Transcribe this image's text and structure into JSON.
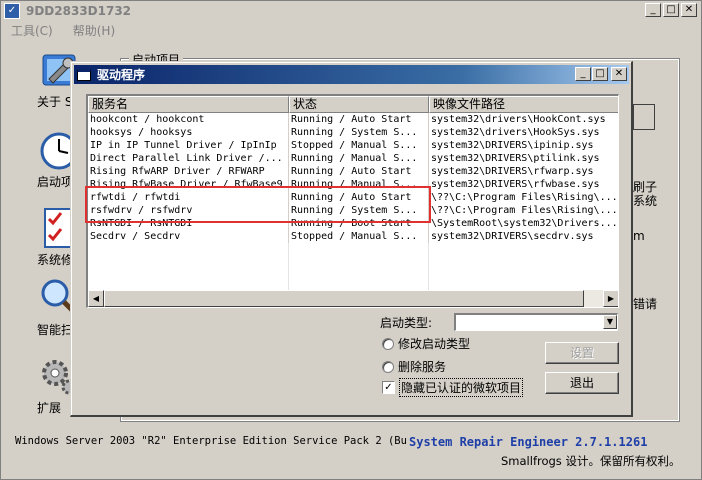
{
  "window": {
    "title": "9DD2833D1732",
    "icon": "app-window-icon"
  },
  "menu": [
    {
      "label": "工具(C)"
    },
    {
      "label": "帮助(H)"
    }
  ],
  "sidebar": {
    "items": [
      {
        "label": "关于 SI",
        "icon": "about-tools-icon"
      },
      {
        "label": "启动项",
        "icon": "clock-icon"
      },
      {
        "label": "系统修",
        "icon": "checklist-icon"
      },
      {
        "label": "智能扫",
        "icon": "magnifier-icon"
      },
      {
        "label": "扩展",
        "icon": "gear-icon"
      }
    ]
  },
  "background": {
    "group_label": "启动项目",
    "right_text_1": "刷子",
    "right_text_2": "系统",
    "right_text_3": "m",
    "right_text_4": "错请"
  },
  "dialog": {
    "title": "驱动程序",
    "columns": [
      "服务名",
      "状态",
      "映像文件路径"
    ],
    "rows": [
      {
        "name": "hookcont / hookcont",
        "status": "Running / Auto Start",
        "path": "system32\\drivers\\HookCont.sys"
      },
      {
        "name": "hooksys / hooksys",
        "status": "Running / System S...",
        "path": "system32\\drivers\\HookSys.sys"
      },
      {
        "name": "IP in IP Tunnel Driver / IpInIp",
        "status": "Stopped / Manual S...",
        "path": "system32\\DRIVERS\\ipinip.sys"
      },
      {
        "name": "Direct Parallel Link Driver /...",
        "status": "Running / Manual S...",
        "path": "system32\\DRIVERS\\ptilink.sys"
      },
      {
        "name": "Rising RfwARP Driver / RFWARP",
        "status": "Running / Auto Start",
        "path": "system32\\DRIVERS\\rfwarp.sys"
      },
      {
        "name": "Rising RfwBase Driver / RfwBase9",
        "status": "Running / Manual S...",
        "path": "system32\\DRIVERS\\rfwbase.sys"
      },
      {
        "name": "rfwtdi / rfwtdi",
        "status": "Running / Auto Start",
        "path": "\\??\\C:\\Program Files\\Rising\\..."
      },
      {
        "name": "rsfwdrv / rsfwdrv",
        "status": "Running / System S...",
        "path": "\\??\\C:\\Program Files\\Rising\\..."
      },
      {
        "name": "RsNTGDI / RsNTGDI",
        "status": "Running / Boot Start",
        "path": "\\SystemRoot\\system32\\Drivers..."
      },
      {
        "name": "Secdrv / Secdrv",
        "status": "Stopped / Manual S...",
        "path": "system32\\DRIVERS\\secdrv.sys"
      }
    ],
    "startup_type_label": "启动类型:",
    "startup_type_value": "",
    "radio_modify": "修改启动类型",
    "radio_delete": "删除服务",
    "checkbox_hide": "隐藏已认证的微软项目",
    "checkbox_hide_checked": true,
    "btn_settings": "设置",
    "btn_exit": "退出"
  },
  "status": {
    "os": "Windows Server 2003 \"R2\" Enterprise Edition Service Pack 2 (Bu...",
    "product": "System Repair Engineer 2.7.1.1261",
    "copyright": "Smallfrogs 设计。保留所有权利。"
  },
  "colors": {
    "highlight": "#e03030",
    "titlebar": "#0a246a",
    "product_text": "#1f3fa8"
  }
}
